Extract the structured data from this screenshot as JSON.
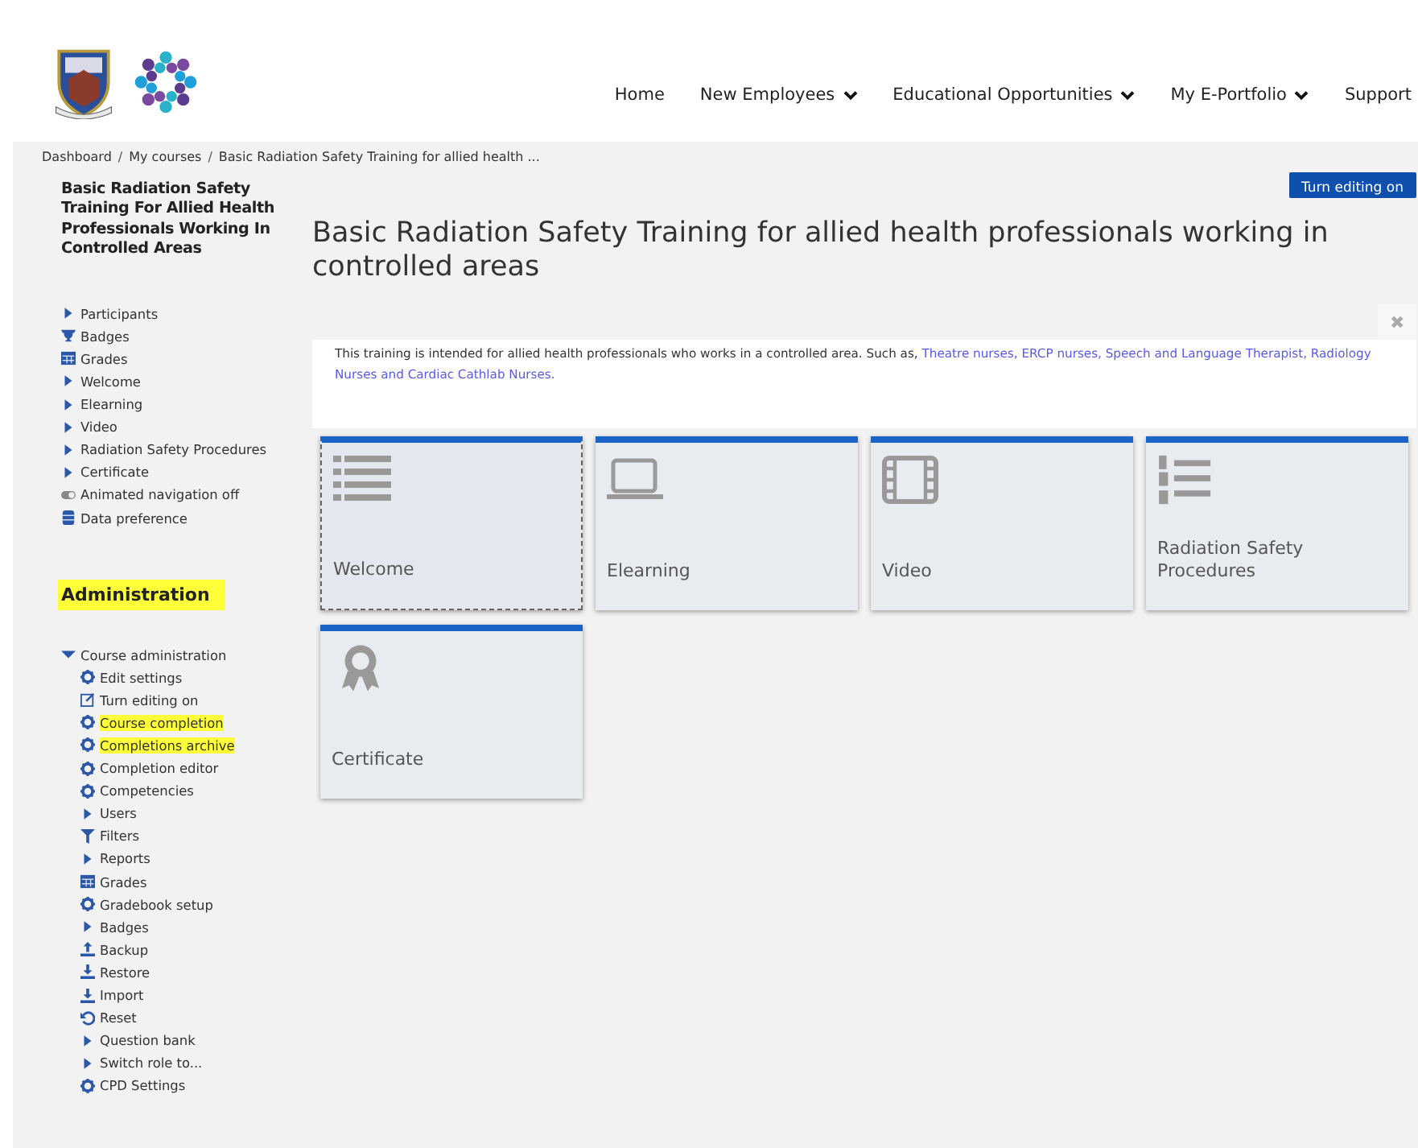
{
  "header": {
    "nav": [
      {
        "label": "Home",
        "dropdown": false
      },
      {
        "label": "New Employees",
        "dropdown": true
      },
      {
        "label": "Educational Opportunities",
        "dropdown": true
      },
      {
        "label": "My E-Portfolio",
        "dropdown": true
      },
      {
        "label": "Support",
        "dropdown": false
      }
    ]
  },
  "breadcrumb": [
    {
      "label": "Dashboard",
      "kind": "link"
    },
    {
      "label": "/",
      "kind": "separator"
    },
    {
      "label": "My courses",
      "kind": "link"
    },
    {
      "label": "/",
      "kind": "separator"
    },
    {
      "label": "Basic Radiation Safety Training for allied health ...",
      "kind": "link"
    }
  ],
  "sidebar": {
    "course_title": "Basic Radiation Safety Training For Allied Health Professionals Working In Controlled Areas",
    "nav": [
      {
        "label": "Participants",
        "kind": "arrow"
      },
      {
        "label": "Badges",
        "kind": "trophy"
      },
      {
        "label": "Grades",
        "kind": "table"
      },
      {
        "label": "Welcome",
        "kind": "arrow"
      },
      {
        "label": "Elearning",
        "kind": "arrow"
      },
      {
        "label": "Video",
        "kind": "arrow"
      },
      {
        "label": "Radiation Safety Procedures",
        "kind": "arrow"
      },
      {
        "label": "Certificate",
        "kind": "arrow"
      },
      {
        "label": "Animated navigation off",
        "kind": "toggle"
      },
      {
        "label": "Data preference",
        "kind": "database"
      }
    ],
    "admin_title": "Administration",
    "admin": [
      {
        "label": "Course administration",
        "kind": "caret",
        "expanded": true,
        "highlighted": false,
        "children": [
          {
            "label": "Edit settings",
            "kind": "gear",
            "highlighted": false
          },
          {
            "label": "Turn editing on",
            "kind": "pencil",
            "highlighted": false
          },
          {
            "label": "Course completion",
            "kind": "gear",
            "highlighted": true
          },
          {
            "label": "Completions archive",
            "kind": "gear",
            "highlighted": true
          },
          {
            "label": "Completion editor",
            "kind": "gear",
            "highlighted": false
          },
          {
            "label": "Competencies",
            "kind": "gear",
            "highlighted": false
          },
          {
            "label": "Users",
            "kind": "arrow",
            "highlighted": false
          },
          {
            "label": "Filters",
            "kind": "filter",
            "highlighted": false
          },
          {
            "label": "Reports",
            "kind": "arrow",
            "highlighted": false
          },
          {
            "label": "Grades",
            "kind": "table",
            "highlighted": false
          },
          {
            "label": "Gradebook setup",
            "kind": "gear",
            "highlighted": false
          },
          {
            "label": "Badges",
            "kind": "arrow",
            "highlighted": false
          },
          {
            "label": "Backup",
            "kind": "upload",
            "highlighted": false
          },
          {
            "label": "Restore",
            "kind": "download",
            "highlighted": false
          },
          {
            "label": "Import",
            "kind": "download",
            "highlighted": false
          },
          {
            "label": "Reset",
            "kind": "reset",
            "highlighted": false
          },
          {
            "label": "Question bank",
            "kind": "arrow",
            "highlighted": false
          },
          {
            "label": "Switch role to...",
            "kind": "arrow",
            "highlighted": false
          },
          {
            "label": "CPD Settings",
            "kind": "gear",
            "highlighted": false
          }
        ]
      }
    ]
  },
  "main": {
    "edit_button": "Turn editing on",
    "title": "Basic Radiation Safety Training for allied health professionals working in controlled areas",
    "close": "✖",
    "summary": {
      "text": "This training is intended for allied health professionals who works in a controlled area. Such as, ",
      "links": [
        "Theatre nurses, ERCP nurses, Speech and Language Therapist, Radiology",
        "Nurses and Cardiac Cathlab Nurses."
      ]
    },
    "tiles": [
      {
        "title": "Welcome",
        "kind": "list",
        "focused": true
      },
      {
        "title": "Elearning",
        "kind": "laptop",
        "focused": false
      },
      {
        "title": "Video",
        "kind": "film",
        "focused": false
      },
      {
        "title": "Radiation Safety Procedures",
        "kind": "numbered",
        "focused": false
      },
      {
        "title": "Certificate",
        "kind": "award",
        "focused": false
      }
    ]
  }
}
